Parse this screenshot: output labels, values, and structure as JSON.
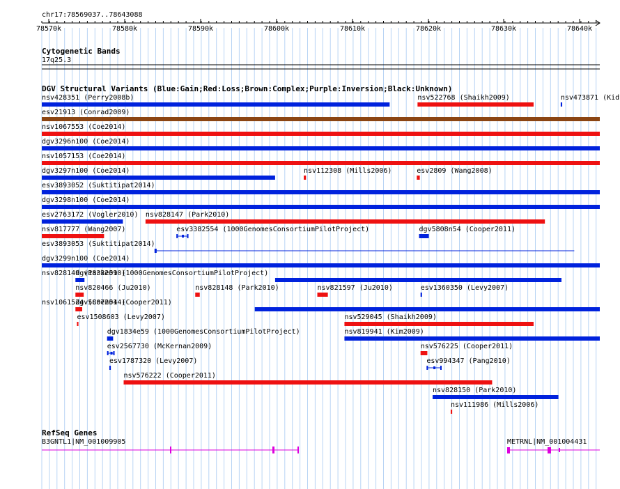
{
  "header": {
    "position": "chr17:78569037..78643088",
    "ruler_ticks": [
      "78570k",
      "78580k",
      "78590k",
      "78600k",
      "78610k",
      "78620k",
      "78630k",
      "78640k"
    ]
  },
  "cytoband": {
    "title": "Cytogenetic Bands",
    "band": "17q25.3"
  },
  "dgv": {
    "title": "DGV Structural Variants (Blue:Gain;Red:Loss;Brown:Complex;Purple:Inversion;Black:Unknown)",
    "colors": {
      "gain": "#0022dd",
      "loss": "#ee1111",
      "complex": "#8b4513",
      "unknown": "#000000"
    },
    "features": [
      {
        "label": "nsv428351 (Perry2008b)",
        "type": "gain",
        "start_kb": 78569.0,
        "end_kb": 78615.2
      },
      {
        "label": "nsv522768 (Shaikh2009)",
        "type": "loss",
        "start_kb": 78618.9,
        "end_kb": 78634.3
      },
      {
        "label": "nsv473871 (Kid",
        "type": "gain",
        "start_kb": 78637.9,
        "end_kb": 78638.1
      },
      {
        "label": "esv21913 (Conrad2009)",
        "type": "complex",
        "start_kb": 78569.0,
        "end_kb": 78643.1
      },
      {
        "label": "nsv1067553 (Coe2014)",
        "type": "loss",
        "start_kb": 78569.0,
        "end_kb": 78643.1
      },
      {
        "label": "dgv3296n100 (Coe2014)",
        "type": "gain",
        "start_kb": 78569.0,
        "end_kb": 78643.1
      },
      {
        "label": "nsv1057153 (Coe2014)",
        "type": "loss",
        "start_kb": 78569.0,
        "end_kb": 78643.1
      },
      {
        "label": "dgv3297n100 (Coe2014)",
        "type": "gain",
        "start_kb": 78569.0,
        "end_kb": 78600.0
      },
      {
        "label": "nsv112308 (Mills2006)",
        "type": "loss",
        "start_kb": 78603.8,
        "end_kb": 78604.1
      },
      {
        "label": "esv2809 (Wang2008)",
        "type": "loss",
        "start_kb": 78618.8,
        "end_kb": 78619.2
      },
      {
        "label": "esv3893052 (Suktitipat2014)",
        "type": "gain",
        "start_kb": 78569.0,
        "end_kb": 78643.1
      },
      {
        "label": "dgv3298n100 (Coe2014)",
        "type": "gain",
        "start_kb": 78569.0,
        "end_kb": 78643.1
      },
      {
        "label": "esv2763172 (Vogler2010)",
        "type": "gain",
        "start_kb": 78569.0,
        "end_kb": 78579.8
      },
      {
        "label": "nsv828147 (Park2010)",
        "type": "loss",
        "start_kb": 78582.8,
        "end_kb": 78635.8
      },
      {
        "label": "nsv817777 (Wang2007)",
        "type": "loss",
        "start_kb": 78569.0,
        "end_kb": 78577.3
      },
      {
        "label": "esv3382554 (1000GenomesConsortiumPilotProject)",
        "type": "gain",
        "start_kb": 78586.9,
        "end_kb": 78588.5
      },
      {
        "label": "dgv5808n54 (Cooper2011)",
        "type": "gain",
        "start_kb": 78619.1,
        "end_kb": 78620.4
      },
      {
        "label": "esv3893053 (Suktitipat2014)",
        "type": "gain",
        "start_kb": 78584.0,
        "end_kb": 78639.7
      },
      {
        "label": "dgv3299n100 (Coe2014)",
        "type": "gain",
        "start_kb": 78569.0,
        "end_kb": 78643.1
      },
      {
        "label": "dgv1833e59 (1000GenomesConsortiumPilotProject)",
        "type": "gain",
        "start_kb": 78573.5,
        "end_kb": 78574.7
      },
      {
        "label": "nsv828149 (Park2010)",
        "type": "gain",
        "start_kb": 78600.0,
        "end_kb": 78638.0
      },
      {
        "label": "nsv820466 (Ju2010)",
        "type": "loss",
        "start_kb": 78573.5,
        "end_kb": 78574.6
      },
      {
        "label": "nsv828148 (Park2010)",
        "type": "loss",
        "start_kb": 78589.4,
        "end_kb": 78590.0
      },
      {
        "label": "nsv821597 (Ju2010)",
        "type": "loss",
        "start_kb": 78605.6,
        "end_kb": 78607.0
      },
      {
        "label": "esv1360350 (Levy2007)",
        "type": "gain",
        "start_kb": 78619.3,
        "end_kb": 78619.5
      },
      {
        "label": "dgv5807n54 (Cooper2011)",
        "type": "loss",
        "start_kb": 78573.5,
        "end_kb": 78574.4
      },
      {
        "label": "nsv1061524 (Coe2014)",
        "type": "gain",
        "start_kb": 78597.3,
        "end_kb": 78643.1
      },
      {
        "label": "esv1508603 (Levy2007)",
        "type": "loss",
        "start_kb": 78573.7,
        "end_kb": 78573.9
      },
      {
        "label": "nsv529045 (Shaikh2009)",
        "type": "loss",
        "start_kb": 78609.2,
        "end_kb": 78634.3
      },
      {
        "label": "dgv1834e59 (1000GenomesConsortiumPilotProject)",
        "type": "gain",
        "start_kb": 78577.7,
        "end_kb": 78578.5
      },
      {
        "label": "nsv819941 (Kim2009)",
        "type": "gain",
        "start_kb": 78609.2,
        "end_kb": 78643.1
      },
      {
        "label": "esv2567730 (McKernan2009)",
        "type": "gain",
        "start_kb": 78577.7,
        "end_kb": 78578.7
      },
      {
        "label": "nsv576225 (Cooper2011)",
        "type": "loss",
        "start_kb": 78619.3,
        "end_kb": 78620.2
      },
      {
        "label": "esv1787320 (Levy2007)",
        "type": "gain",
        "start_kb": 78578.0,
        "end_kb": 78578.2
      },
      {
        "label": "esv994347 (Pang2010)",
        "type": "gain",
        "start_kb": 78620.1,
        "end_kb": 78622.1
      },
      {
        "label": "nsv576222 (Cooper2011)",
        "type": "loss",
        "start_kb": 78579.9,
        "end_kb": 78628.8
      },
      {
        "label": "nsv828150 (Park2010)",
        "type": "gain",
        "start_kb": 78620.9,
        "end_kb": 78637.6
      },
      {
        "label": "nsv111986 (Mills2006)",
        "type": "loss",
        "start_kb": 78623.3,
        "end_kb": 78623.5
      }
    ]
  },
  "refseq": {
    "title": "RefSeq Genes",
    "color": "#dd00dd",
    "genes": [
      {
        "label": "B3GNTL1|NM_001009905"
      },
      {
        "label": "METRNL|NM_001004431"
      }
    ]
  }
}
